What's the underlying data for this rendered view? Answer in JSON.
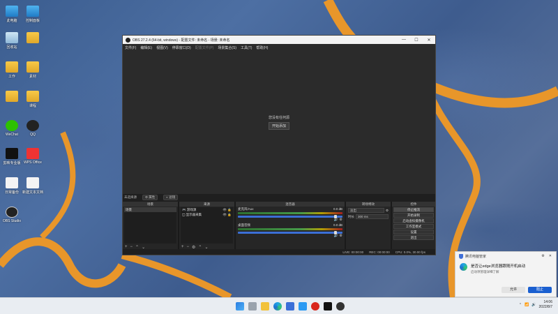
{
  "desktop": {
    "icons": [
      {
        "label": "此电脑",
        "kind": "pc"
      },
      {
        "label": "控制面板",
        "kind": "pc"
      },
      {
        "label": "回收站",
        "kind": "recycle"
      },
      {
        "label": "",
        "kind": "folder"
      },
      {
        "label": "工作",
        "kind": "folder"
      },
      {
        "label": "素材",
        "kind": "folder"
      },
      {
        "label": "",
        "kind": "folder"
      },
      {
        "label": "课程",
        "kind": "folder"
      },
      {
        "label": "WeChat",
        "kind": "wechat"
      },
      {
        "label": "QQ",
        "kind": "qq"
      },
      {
        "label": "剪映专业版",
        "kind": "capcut"
      },
      {
        "label": "WPS Office",
        "kind": "wps"
      },
      {
        "label": "日常备份",
        "kind": "doc"
      },
      {
        "label": "新建文本文档",
        "kind": "doc"
      },
      {
        "label": "OBS Studio",
        "kind": "obs"
      }
    ]
  },
  "obs": {
    "title": "OBS 27.2.4 (64-bit, windows) - 配置文件: 未命名 - 场景: 未命名",
    "controls": {
      "minimize": "—",
      "maximize": "☐",
      "close": "✕"
    },
    "menu": [
      "文件(F)",
      "编辑(E)",
      "视图(V)",
      "停靠窗口(D)",
      "配置文件(P)",
      "场景集合(S)",
      "工具(T)",
      "帮助(H)"
    ],
    "preview": {
      "message": "您没有任何源",
      "button": "开始添加"
    },
    "source_bar": {
      "label": "未选择源",
      "properties": "⚙ 属性",
      "filters": "◐ 滤镜"
    },
    "docks": {
      "scenes": {
        "title": "场景",
        "items": [
          "场景"
        ]
      },
      "sources": {
        "title": "来源",
        "items": [
          "游戏源",
          "显示器采集"
        ]
      },
      "mixer": {
        "title": "混音器",
        "channels": [
          {
            "name": "麦克风/Aux",
            "db": "0.0 dB"
          },
          {
            "name": "桌面音频",
            "db": "0.0 dB"
          }
        ]
      },
      "transitions": {
        "title": "转场特效",
        "type": "淡出",
        "duration_label": "时长",
        "duration": "300 ms"
      },
      "controls": {
        "title": "控件",
        "buttons": [
          "停止推流",
          "开始录制",
          "启动虚拟摄像机",
          "工作室模式",
          "设置",
          "退出"
        ]
      }
    },
    "status": {
      "live": "LIVE: 00:00:00",
      "rec": "REC: 00:00:00",
      "cpu": "CPU: 0.0%, 30.00 fps"
    }
  },
  "toast": {
    "app": "腾讯电脑管家",
    "message": "是否让edge浏览器跟随开机启动",
    "sub": "启动项管理详细了解",
    "allow": "允许",
    "block": "阻止"
  },
  "taskbar": {
    "time": "14:06",
    "date": "2022/8/7"
  },
  "colors": {
    "obs_bg": "#1e1e1e",
    "accent_blue": "#1a5fd0",
    "river_orange": "#e8962a"
  }
}
